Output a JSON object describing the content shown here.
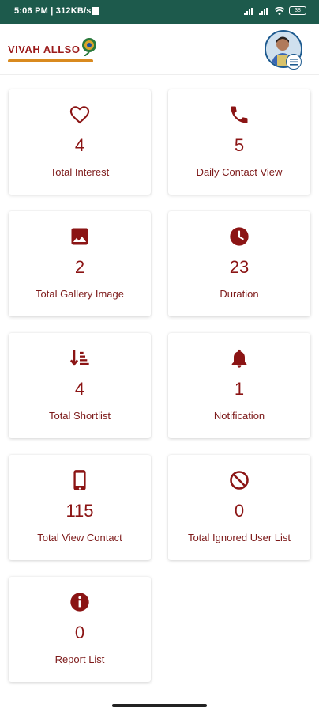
{
  "status_bar": {
    "time_speed": "5:06 PM | 312KB/s",
    "battery": "38"
  },
  "header": {
    "logo_text": "VIVAH ALLSO"
  },
  "colors": {
    "status_bar": "#1d5a4c",
    "accent": "#8b1414",
    "card_bg": "#ffffff"
  },
  "cards": [
    {
      "value": "4",
      "label": "Total Interest",
      "icon": "heart-outline-icon"
    },
    {
      "value": "5",
      "label": "Daily Contact View",
      "icon": "phone-icon"
    },
    {
      "value": "2",
      "label": "Total Gallery Image",
      "icon": "image-icon"
    },
    {
      "value": "23",
      "label": "Duration",
      "icon": "clock-icon"
    },
    {
      "value": "4",
      "label": "Total Shortlist",
      "icon": "sort-list-icon"
    },
    {
      "value": "1",
      "label": "Notification",
      "icon": "bell-icon"
    },
    {
      "value": "115",
      "label": "Total View Contact",
      "icon": "mobile-phone-icon"
    },
    {
      "value": "0",
      "label": "Total Ignored User List",
      "icon": "block-icon"
    },
    {
      "value": "0",
      "label": "Report List",
      "icon": "info-icon"
    }
  ]
}
